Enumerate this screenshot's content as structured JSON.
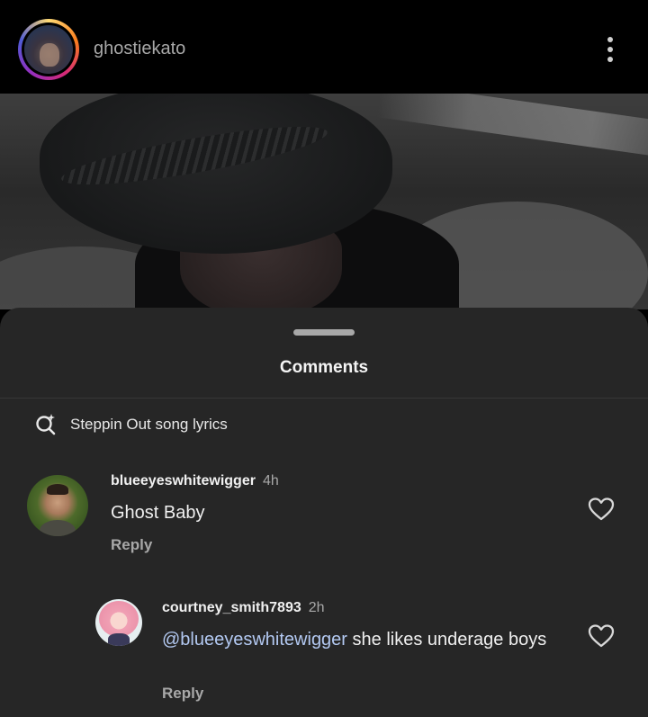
{
  "header": {
    "username": "ghostiekato"
  },
  "comments_sheet": {
    "title": "Comments",
    "search_suggestion": "Steppin Out song lyrics"
  },
  "comments": [
    {
      "username": "blueeyeswhitewigger",
      "time": "4h",
      "text": "Ghost Baby",
      "reply_label": "Reply"
    },
    {
      "username": "courtney_smith7893",
      "time": "2h",
      "mention": "@blueeyeswhitewigger",
      "text": " she likes underage boys",
      "reply_label": "Reply"
    }
  ],
  "colors": {
    "sheet_bg": "#262626",
    "mention": "#b3c9f2",
    "muted_text": "#a8a8a8"
  }
}
